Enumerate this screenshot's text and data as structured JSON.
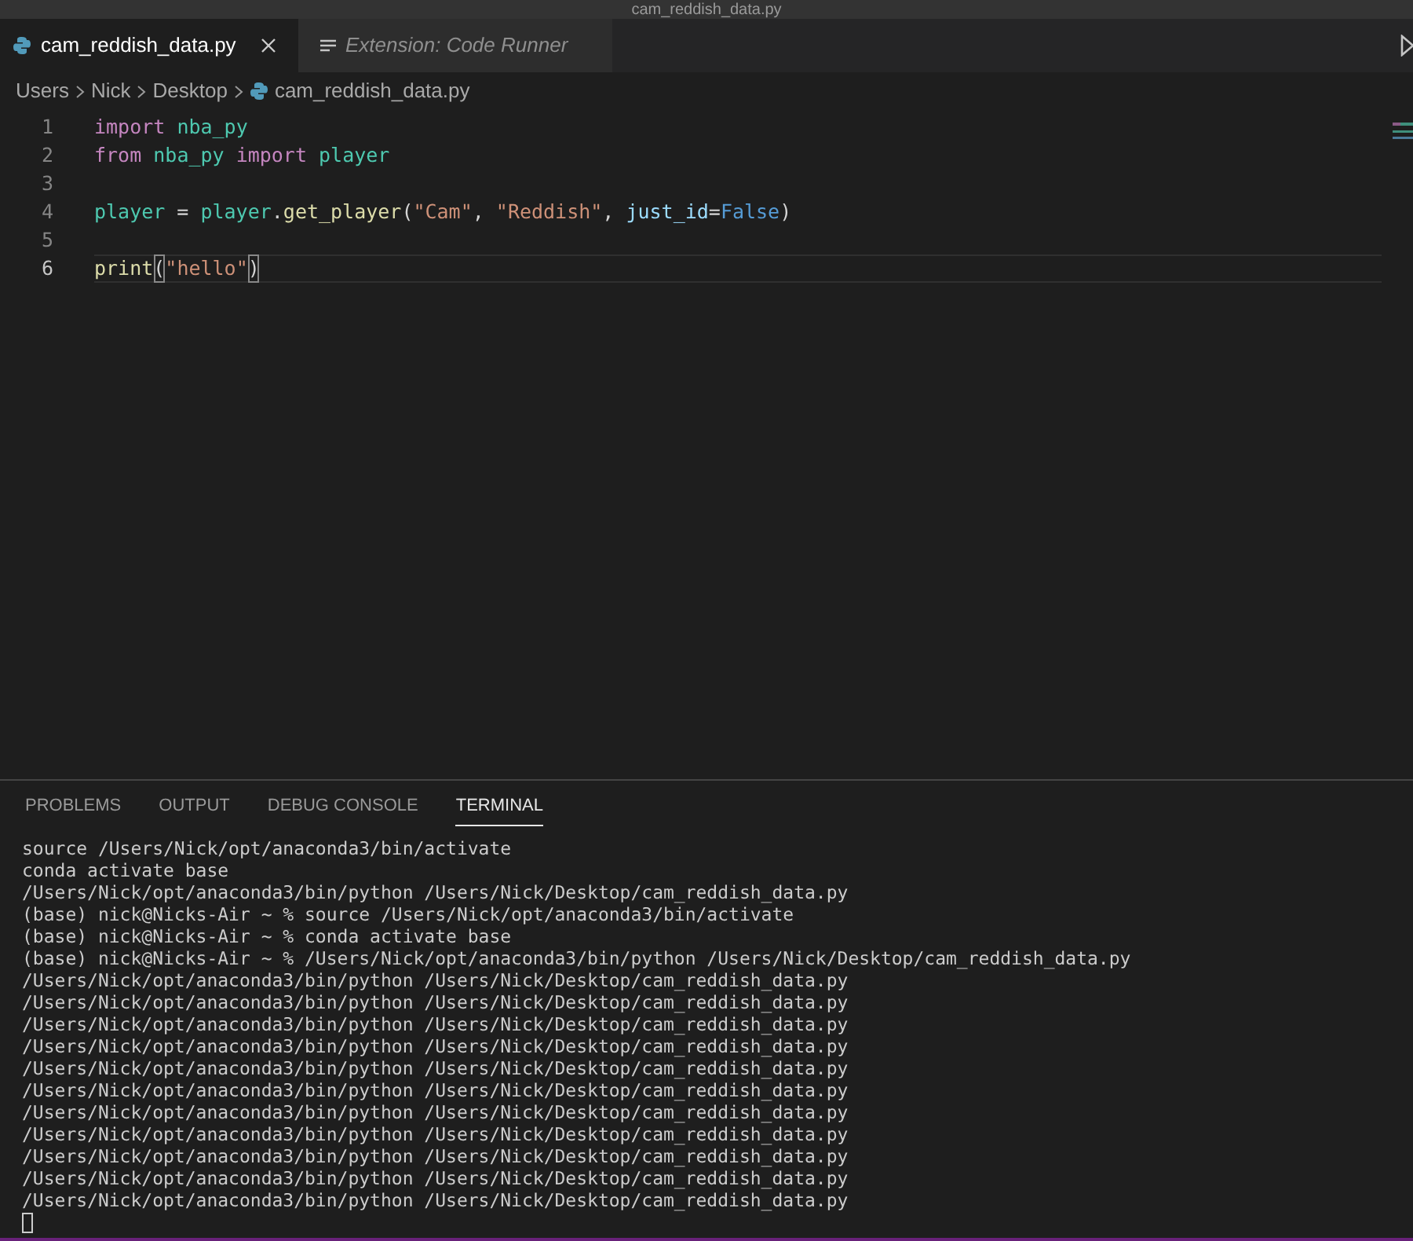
{
  "window": {
    "title": "cam_reddish_data.py"
  },
  "tabs": [
    {
      "label": "cam_reddish_data.py",
      "kind": "python",
      "selected": true
    },
    {
      "label": "Extension: Code Runner",
      "kind": "extension",
      "selected": false
    }
  ],
  "breadcrumbs": [
    {
      "label": "Users",
      "kind": "folder"
    },
    {
      "label": "Nick",
      "kind": "folder"
    },
    {
      "label": "Desktop",
      "kind": "folder"
    },
    {
      "label": "cam_reddish_data.py",
      "kind": "python"
    }
  ],
  "editor": {
    "lines": [
      {
        "number": "1",
        "current": false,
        "tokens": [
          {
            "text": "import ",
            "kind": "keyword"
          },
          {
            "text": "nba_py",
            "kind": "module"
          }
        ]
      },
      {
        "number": "2",
        "current": false,
        "tokens": [
          {
            "text": "from ",
            "kind": "keyword"
          },
          {
            "text": "nba_py ",
            "kind": "module"
          },
          {
            "text": "import ",
            "kind": "keyword"
          },
          {
            "text": "player",
            "kind": "module"
          }
        ]
      },
      {
        "number": "3",
        "current": false
      },
      {
        "number": "4",
        "current": false,
        "tokens": [
          {
            "text": "player",
            "kind": "module"
          },
          {
            "text": " = ",
            "kind": "plain"
          },
          {
            "text": "player",
            "kind": "module"
          },
          {
            "text": ".",
            "kind": "plain"
          },
          {
            "text": "get_player",
            "kind": "function"
          },
          {
            "text": "(",
            "kind": "plain"
          },
          {
            "text": "\"Cam\"",
            "kind": "string"
          },
          {
            "text": ", ",
            "kind": "plain"
          },
          {
            "text": "\"Reddish\"",
            "kind": "string"
          },
          {
            "text": ", ",
            "kind": "plain"
          },
          {
            "text": "just_id",
            "kind": "parameter"
          },
          {
            "text": "=",
            "kind": "plain"
          },
          {
            "text": "False",
            "kind": "constant"
          },
          {
            "text": ")",
            "kind": "plain"
          }
        ]
      },
      {
        "number": "5",
        "current": false
      },
      {
        "number": "6",
        "current": true,
        "tokens": [
          {
            "text": "print",
            "kind": "function"
          },
          {
            "text": "(",
            "kind": "bracket_match"
          },
          {
            "text": "\"hello\"",
            "kind": "string"
          },
          {
            "text": ")",
            "kind": "bracket_match"
          }
        ]
      }
    ]
  },
  "panel": {
    "tabs": [
      {
        "label": "PROBLEMS",
        "selected": false
      },
      {
        "label": "OUTPUT",
        "selected": false
      },
      {
        "label": "DEBUG CONSOLE",
        "selected": false
      },
      {
        "label": "TERMINAL",
        "selected": true
      }
    ],
    "terminal_lines": [
      "source /Users/Nick/opt/anaconda3/bin/activate",
      "conda activate base",
      "/Users/Nick/opt/anaconda3/bin/python /Users/Nick/Desktop/cam_reddish_data.py",
      "(base) nick@Nicks-Air ~ % source /Users/Nick/opt/anaconda3/bin/activate",
      "(base) nick@Nicks-Air ~ % conda activate base",
      "(base) nick@Nicks-Air ~ % /Users/Nick/opt/anaconda3/bin/python /Users/Nick/Desktop/cam_reddish_data.py",
      "/Users/Nick/opt/anaconda3/bin/python /Users/Nick/Desktop/cam_reddish_data.py",
      "/Users/Nick/opt/anaconda3/bin/python /Users/Nick/Desktop/cam_reddish_data.py",
      "/Users/Nick/opt/anaconda3/bin/python /Users/Nick/Desktop/cam_reddish_data.py",
      "/Users/Nick/opt/anaconda3/bin/python /Users/Nick/Desktop/cam_reddish_data.py",
      "/Users/Nick/opt/anaconda3/bin/python /Users/Nick/Desktop/cam_reddish_data.py",
      "/Users/Nick/opt/anaconda3/bin/python /Users/Nick/Desktop/cam_reddish_data.py",
      "/Users/Nick/opt/anaconda3/bin/python /Users/Nick/Desktop/cam_reddish_data.py",
      "/Users/Nick/opt/anaconda3/bin/python /Users/Nick/Desktop/cam_reddish_data.py",
      "/Users/Nick/opt/anaconda3/bin/python /Users/Nick/Desktop/cam_reddish_data.py",
      "/Users/Nick/opt/anaconda3/bin/python /Users/Nick/Desktop/cam_reddish_data.py",
      "/Users/Nick/opt/anaconda3/bin/python /Users/Nick/Desktop/cam_reddish_data.py"
    ]
  }
}
